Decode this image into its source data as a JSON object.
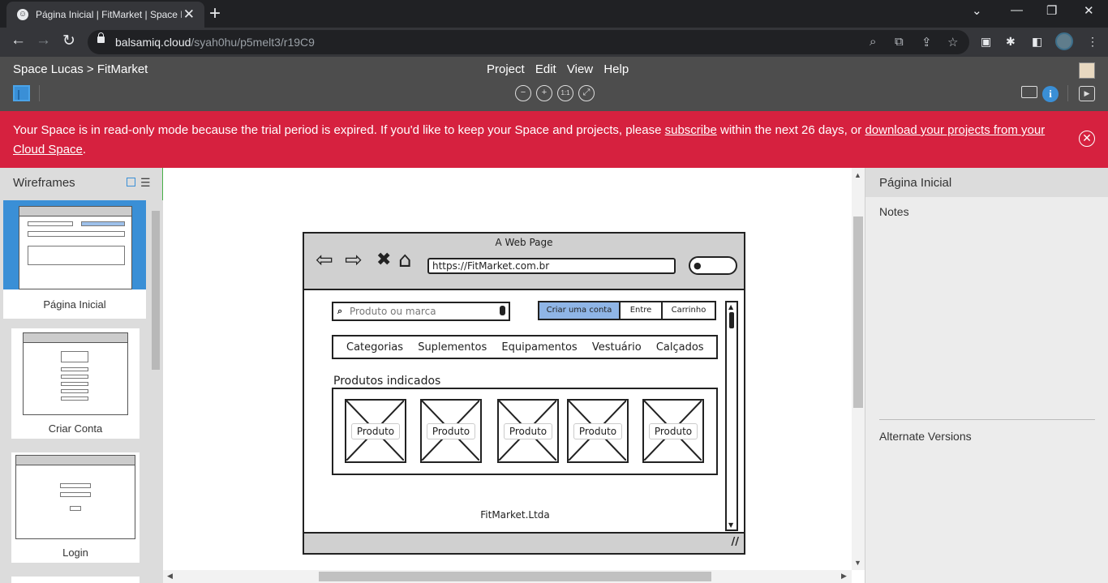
{
  "browser": {
    "tab_title": "Página Inicial | FitMarket | Space Lucas",
    "tab_close": "✕",
    "new_tab": "+",
    "window_controls": {
      "minimize": "—",
      "restore": "❐",
      "close": "✕",
      "menu": "⌄"
    },
    "url_domain": "balsamiq.cloud",
    "url_path": "/syah0hu/p5melt3/r19C9",
    "nav": {
      "back": "←",
      "forward": "→",
      "reload": "↻"
    }
  },
  "app": {
    "breadcrumb": "Space Lucas > FitMarket",
    "menu": [
      "Project",
      "Edit",
      "View",
      "Help"
    ],
    "zoom_controls": [
      "−",
      "+",
      "1:1",
      "⤢"
    ]
  },
  "banner": {
    "text_before": "Your Space is in read-only mode because the trial period is expired. If you'd like to keep your Space and projects, please ",
    "link1": "subscribe",
    "text_middle": " within the next 26 days, or ",
    "link2": "download your projects from your Cloud Space",
    "text_after": ".",
    "close": "✕"
  },
  "left_panel": {
    "title": "Wireframes",
    "list_icon": "☰",
    "items": [
      {
        "label": "Página Inicial",
        "selected": true
      },
      {
        "label": "Criar Conta",
        "selected": false
      },
      {
        "label": "Login",
        "selected": false
      }
    ]
  },
  "wireframe": {
    "window_title": "A Web Page",
    "url": "https://FitMarket.com.br",
    "nav_icons": [
      "⇦",
      "⇨",
      "✖",
      "⌂"
    ],
    "search_placeholder": "Produto ou marca",
    "buttons": [
      "Criar uma conta",
      "Entre",
      "Carrinho"
    ],
    "menu": [
      "Categorias",
      "Suplementos",
      "Equipamentos",
      "Vestuário",
      "Calçados"
    ],
    "section_title": "Produtos indicados",
    "products": [
      "Produto",
      "Produto",
      "Produto",
      "Produto",
      "Produto"
    ],
    "footer": "FitMarket.Ltda"
  },
  "right_panel": {
    "title": "Página Inicial",
    "notes": "Notes",
    "alternate": "Alternate Versions"
  }
}
